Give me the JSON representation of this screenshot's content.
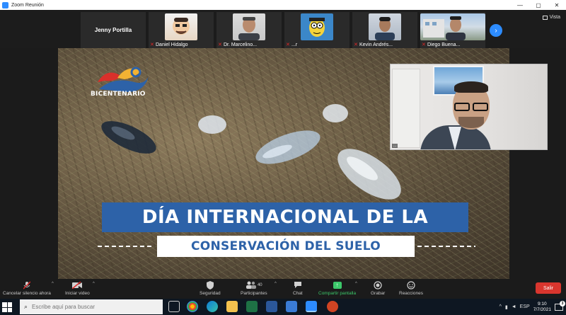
{
  "window": {
    "title": "Zoom Reunión",
    "minimize": "—",
    "maximize": "▢",
    "close": "✕"
  },
  "view_button": {
    "label": "Vista"
  },
  "participants": [
    {
      "name": "Jenny Portilla",
      "video": false,
      "muted": false
    },
    {
      "name": "Daniel Hidalgo",
      "video": true,
      "muted": true
    },
    {
      "name": "Dr. Marcelino...",
      "video": true,
      "muted": true
    },
    {
      "name": "...r",
      "video": true,
      "muted": true
    },
    {
      "name": "Kevin Andrés...",
      "video": true,
      "muted": true
    },
    {
      "name": "Diego Buena...",
      "video": true,
      "muted": true
    }
  ],
  "next_page_icon": "›",
  "slide": {
    "logo_text": "BICENTENARIO",
    "banner_line1": "DÍA INTERNACIONAL DE LA",
    "banner_line2": "CONSERVACIÓN DEL SUELO"
  },
  "speaker": {
    "label": "..."
  },
  "toolbar": {
    "unmute": "Cancelar silencio ahora",
    "start_video": "Iniciar video",
    "security": "Seguridad",
    "participants": "Participantes",
    "participants_count": "40",
    "chat": "Chat",
    "share_screen": "Compartir pantalla",
    "record": "Grabar",
    "reactions": "Reacciones",
    "leave": "Salir",
    "caret": "^"
  },
  "taskbar": {
    "search_placeholder": "Escribe aquí para buscar",
    "language": "ESP",
    "time": "9:10",
    "date": "7/7/2021",
    "notification_count": "3"
  },
  "colors": {
    "zoom_blue": "#2d8cff",
    "banner_blue": "#2d62a8",
    "leave_red": "#d9362e",
    "share_green": "#3cc86a",
    "muted_red": "#e02828"
  }
}
